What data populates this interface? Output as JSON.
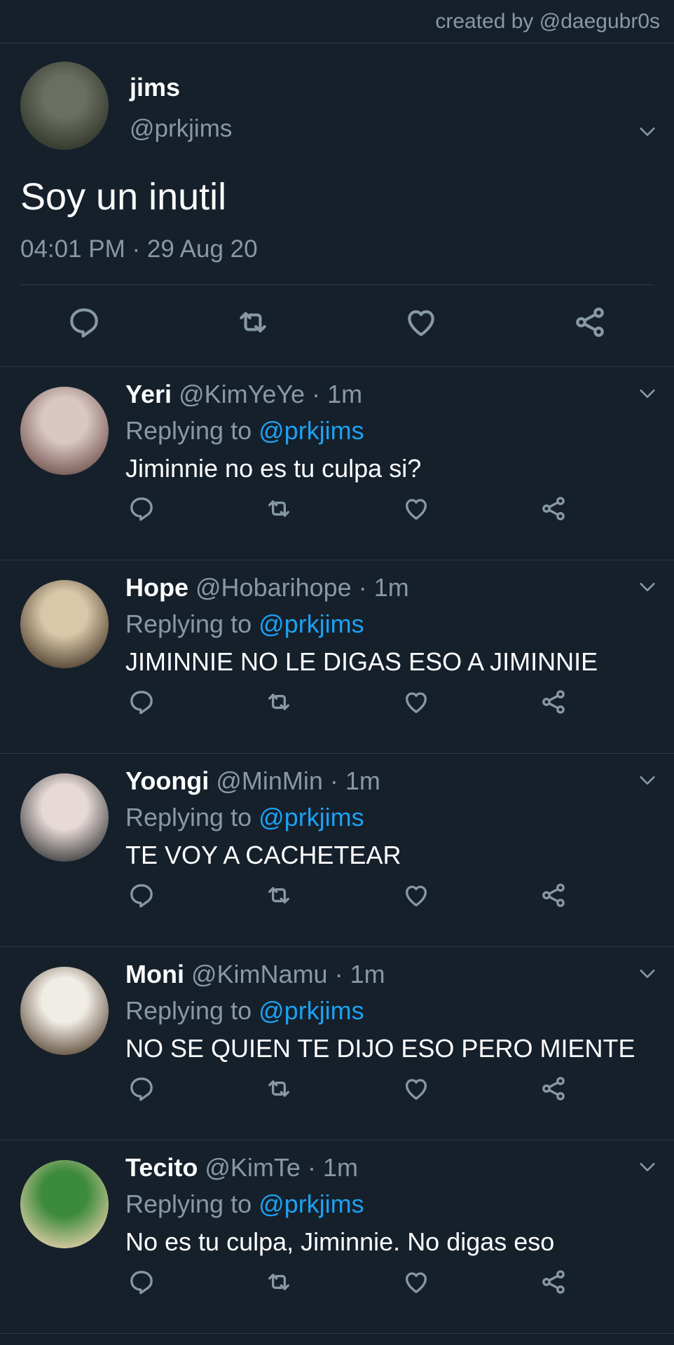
{
  "credit": "created by @daegubr0s",
  "main_tweet": {
    "name": "jims",
    "handle": "@prkjims",
    "text": "Soy un inutil",
    "timestamp": "04:01 PM · 29 Aug 20",
    "avatar_colors": [
      "#6b6f63",
      "#2d3326"
    ]
  },
  "replies": [
    {
      "name": "Yeri",
      "handle": "@KimYeYe",
      "time": "· 1m",
      "replying_prefix": "Replying to",
      "mention": "@prkjims",
      "text": "Jiminnie no es tu culpa si?",
      "avatar_colors": [
        "#d9c7c2",
        "#7a5c56"
      ]
    },
    {
      "name": "Hope",
      "handle": "@Hobarihope",
      "time": "· 1m",
      "replying_prefix": "Replying to",
      "mention": "@prkjims",
      "text": "JIMINNIE NO LE DIGAS ESO A JIMINNIE",
      "avatar_colors": [
        "#d8c7a8",
        "#5a4a38"
      ]
    },
    {
      "name": "Yoongi",
      "handle": "@MinMin",
      "time": "· 1m",
      "replying_prefix": "Replying to",
      "mention": "@prkjims",
      "text": "TE VOY A CACHETEAR",
      "avatar_colors": [
        "#e6d9d6",
        "#4a4a4a"
      ]
    },
    {
      "name": "Moni",
      "handle": "@KimNamu",
      "time": "· 1m",
      "replying_prefix": "Replying to",
      "mention": "@prkjims",
      "text": "NO SE QUIEN TE DIJO ESO PERO MIENTE",
      "avatar_colors": [
        "#f0ece6",
        "#6b5a48"
      ]
    },
    {
      "name": "Tecito",
      "handle": "@KimTe",
      "time": "· 1m",
      "replying_prefix": "Replying to",
      "mention": "@prkjims",
      "text": "No es tu culpa, Jiminnie. No digas eso",
      "avatar_colors": [
        "#3c8a3c",
        "#d6c9a0"
      ]
    }
  ],
  "icons": [
    "reply-icon",
    "retweet-icon",
    "like-icon",
    "share-icon",
    "chevron-down-icon"
  ],
  "colors": {
    "background": "#15202b",
    "secondary_text": "#8899a6",
    "mention": "#1da1f2",
    "divider": "#2b3a48"
  }
}
